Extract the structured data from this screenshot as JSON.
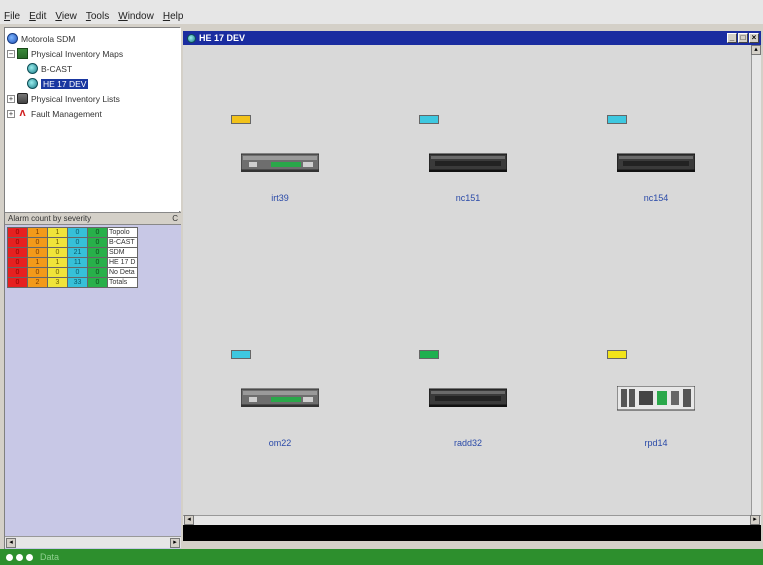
{
  "menu": [
    "File",
    "Edit",
    "View",
    "Tools",
    "Window",
    "Help"
  ],
  "tree": [
    {
      "label": "Motorola SDM",
      "icon": "globe-icon",
      "expander": "",
      "indent": 0
    },
    {
      "label": "Physical Inventory Maps",
      "icon": "maps-icon",
      "expander": "−",
      "indent": 1
    },
    {
      "label": "B-CAST",
      "icon": "globe-teal-icon",
      "expander": "",
      "indent": 2
    },
    {
      "label": "HE 17 DEV",
      "icon": "globe-teal-icon",
      "expander": "",
      "indent": 2,
      "selected": true
    },
    {
      "label": "Physical Inventory Lists",
      "icon": "lists-icon",
      "expander": "+",
      "indent": 1
    },
    {
      "label": "Fault Management",
      "icon": "fault-icon",
      "expander": "+",
      "indent": 1
    }
  ],
  "alarm": {
    "title": "Alarm count by severity",
    "col_hint": "C",
    "rows": [
      {
        "counts": [
          "0",
          "1",
          "1",
          "0",
          "0"
        ],
        "name": "Topolo"
      },
      {
        "counts": [
          "0",
          "0",
          "1",
          "0",
          "0"
        ],
        "name": "B-CAST"
      },
      {
        "counts": [
          "0",
          "0",
          "0",
          "21",
          "0"
        ],
        "name": "SDM"
      },
      {
        "counts": [
          "0",
          "1",
          "1",
          "11",
          "0"
        ],
        "name": "HE 17 D"
      },
      {
        "counts": [
          "0",
          "0",
          "0",
          "0",
          "0"
        ],
        "name": "No Deta"
      },
      {
        "counts": [
          "0",
          "2",
          "3",
          "33",
          "0"
        ],
        "name": "Totals"
      }
    ]
  },
  "map_window": {
    "title": "HE 17 DEV",
    "controls": [
      "_",
      "□",
      "×"
    ]
  },
  "devices": [
    {
      "label": "irt39",
      "status_color": "#f2c21a",
      "style": "green-panel"
    },
    {
      "label": "nc151",
      "status_color": "#3ec8e0",
      "style": "dark"
    },
    {
      "label": "nc154",
      "status_color": "#3ec8e0",
      "style": "dark"
    },
    {
      "label": "om22",
      "status_color": "#3ec8e0",
      "style": "green-panel"
    },
    {
      "label": "radd32",
      "status_color": "#1fb04f",
      "style": "dark"
    },
    {
      "label": "rpd14",
      "status_color": "#f2e41a",
      "style": "multi"
    }
  ],
  "statusbar": {
    "text": "Data"
  }
}
